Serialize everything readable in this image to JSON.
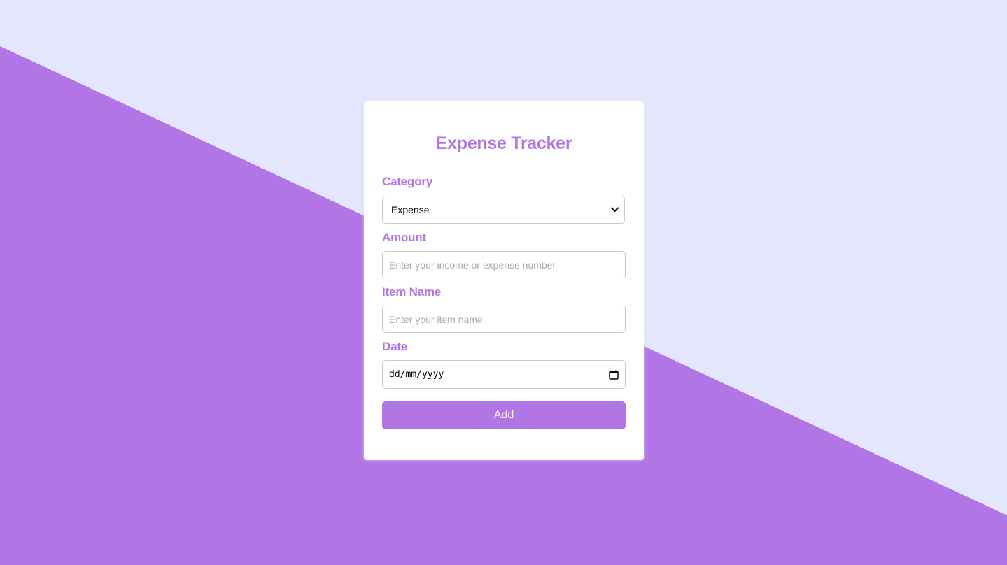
{
  "colors": {
    "accent": "#b275e5",
    "background_light": "#e3e6fd",
    "card": "#ffffff"
  },
  "form": {
    "title": "Expense Tracker",
    "category": {
      "label": "Category",
      "selected": "Expense",
      "icon": "chevron-down-icon"
    },
    "amount": {
      "label": "Amount",
      "placeholder": "Enter your income or expense number"
    },
    "item_name": {
      "label": "Item Name",
      "placeholder": "Enter your item name"
    },
    "date": {
      "label": "Date",
      "value_format": "dd/mm/yyyy",
      "icon": "calendar-icon"
    },
    "submit_label": "Add"
  }
}
